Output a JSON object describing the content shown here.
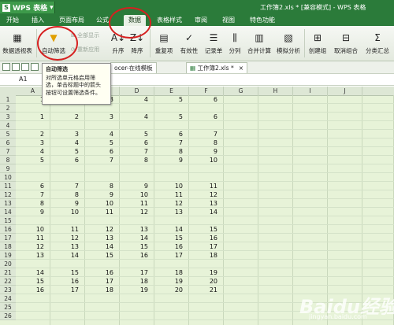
{
  "app": {
    "name": "WPS 表格",
    "logo": "S",
    "title": "工作簿2.xls * [兼容模式] - WPS 表格"
  },
  "menu_tabs": [
    "开始",
    "插入",
    "页面布局",
    "公式",
    "数据",
    "表格样式",
    "审阅",
    "视图",
    "特色功能"
  ],
  "active_tab": "数据",
  "ribbon": {
    "pivot": "数据透视表",
    "autofilter": "自动筛选",
    "show_all": "全部显示",
    "reapply": "重新应用",
    "sort_asc": "升序",
    "sort_desc": "降序",
    "duplicates": "重复项",
    "validity": "有效性",
    "record": "记录单",
    "split": "分列",
    "consolidate": "合并计算",
    "simulation": "模拟分析",
    "group": "创建组",
    "ungroup": "取消组合",
    "subtotal": "分类汇总"
  },
  "doc_tabs": [
    "ocer-在线模板",
    "工作簿2.xls *"
  ],
  "formula_bar": {
    "cell_ref": "A1",
    "value": "1"
  },
  "tooltip": {
    "title": "自动筛选",
    "line1": "对所选单元格启用筛",
    "line2": "选，单击标题中的箭头",
    "line3": "按钮可设置筛选条件。"
  },
  "columns": [
    "A",
    "B",
    "C",
    "D",
    "E",
    "F",
    "G",
    "H",
    "I",
    "J"
  ],
  "rows": [
    {
      "n": "1",
      "v": [
        "1",
        "2",
        "3",
        "4",
        "5",
        "6"
      ]
    },
    {
      "n": "2",
      "v": [
        "",
        "",
        "",
        "",
        "",
        ""
      ]
    },
    {
      "n": "3",
      "v": [
        "1",
        "2",
        "3",
        "4",
        "5",
        "6"
      ]
    },
    {
      "n": "4",
      "v": [
        "",
        "",
        "",
        "",
        "",
        ""
      ]
    },
    {
      "n": "5",
      "v": [
        "2",
        "3",
        "4",
        "5",
        "6",
        "7"
      ]
    },
    {
      "n": "6",
      "v": [
        "3",
        "4",
        "5",
        "6",
        "7",
        "8"
      ]
    },
    {
      "n": "7",
      "v": [
        "4",
        "5",
        "6",
        "7",
        "8",
        "9"
      ]
    },
    {
      "n": "8",
      "v": [
        "5",
        "6",
        "7",
        "8",
        "9",
        "10"
      ]
    },
    {
      "n": "9",
      "v": [
        "",
        "",
        "",
        "",
        "",
        ""
      ]
    },
    {
      "n": "10",
      "v": [
        "",
        "",
        "",
        "",
        "",
        ""
      ]
    },
    {
      "n": "11",
      "v": [
        "6",
        "7",
        "8",
        "9",
        "10",
        "11"
      ]
    },
    {
      "n": "12",
      "v": [
        "7",
        "8",
        "9",
        "10",
        "11",
        "12"
      ]
    },
    {
      "n": "13",
      "v": [
        "8",
        "9",
        "10",
        "11",
        "12",
        "13"
      ]
    },
    {
      "n": "14",
      "v": [
        "9",
        "10",
        "11",
        "12",
        "13",
        "14"
      ]
    },
    {
      "n": "15",
      "v": [
        "",
        "",
        "",
        "",
        "",
        ""
      ]
    },
    {
      "n": "16",
      "v": [
        "10",
        "11",
        "12",
        "13",
        "14",
        "15"
      ]
    },
    {
      "n": "17",
      "v": [
        "11",
        "12",
        "13",
        "14",
        "15",
        "16"
      ]
    },
    {
      "n": "18",
      "v": [
        "12",
        "13",
        "14",
        "15",
        "16",
        "17"
      ]
    },
    {
      "n": "19",
      "v": [
        "13",
        "14",
        "15",
        "16",
        "17",
        "18"
      ]
    },
    {
      "n": "20",
      "v": [
        "",
        "",
        "",
        "",
        "",
        ""
      ]
    },
    {
      "n": "21",
      "v": [
        "14",
        "15",
        "16",
        "17",
        "18",
        "19"
      ]
    },
    {
      "n": "22",
      "v": [
        "15",
        "16",
        "17",
        "18",
        "19",
        "20"
      ]
    },
    {
      "n": "23",
      "v": [
        "16",
        "17",
        "18",
        "19",
        "20",
        "21"
      ]
    },
    {
      "n": "24",
      "v": [
        "",
        "",
        "",
        "",
        "",
        ""
      ]
    },
    {
      "n": "25",
      "v": [
        "",
        "",
        "",
        "",
        "",
        ""
      ]
    },
    {
      "n": "26",
      "v": [
        "",
        "",
        "",
        "",
        "",
        ""
      ]
    }
  ],
  "watermark": {
    "brand": "Baidu经验",
    "url": "jingyan.baidu.com"
  },
  "colors": {
    "brand_green": "#2b7b3a",
    "annotation_red": "#d62020",
    "grid_bg": "#e7f3d8"
  }
}
